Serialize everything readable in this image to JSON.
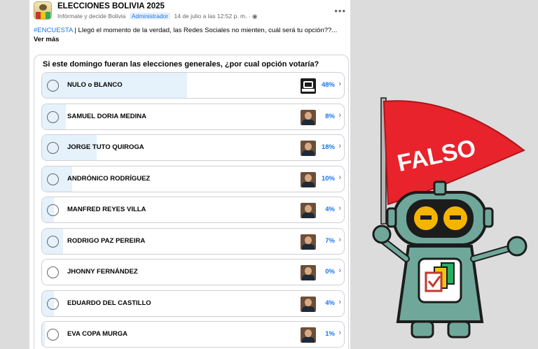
{
  "post": {
    "group_name": "ELECCIONES BOLIVIA 2025",
    "subtitle": "Infórmate y decide Bolivia",
    "role_badge": "Administrador",
    "timestamp": "14 de julio a las 12:52 p. m. ·",
    "more_icon": "more-horizontal-icon",
    "hashtag": "#ENCUESTA",
    "text": " | Llegó el momento de la verdad, las Redes Sociales no mienten, cuál será tu opción??...",
    "see_more": "Ver más"
  },
  "poll": {
    "question": "Si este domingo fueran las elecciones generales, ¿por cual opción votaría?",
    "options": [
      {
        "label": "NULO o BLANCO",
        "percent": 48,
        "percent_text": "48%"
      },
      {
        "label": "SAMUEL DORIA MEDINA",
        "percent": 8,
        "percent_text": "8%"
      },
      {
        "label": "JORGE TUTO QUIROGA",
        "percent": 18,
        "percent_text": "18%"
      },
      {
        "label": "ANDRÓNICO RODRÍGUEZ",
        "percent": 10,
        "percent_text": "10%"
      },
      {
        "label": "MANFRED REYES VILLA",
        "percent": 4,
        "percent_text": "4%"
      },
      {
        "label": "RODRIGO PAZ PEREIRA",
        "percent": 7,
        "percent_text": "7%"
      },
      {
        "label": "JHONNY FERNÁNDEZ",
        "percent": 0,
        "percent_text": "0%"
      },
      {
        "label": "EDUARDO DEL CASTILLO",
        "percent": 4,
        "percent_text": "4%"
      },
      {
        "label": "EVA COPA MURGA",
        "percent": 1,
        "percent_text": "1%"
      }
    ],
    "chevron": "›"
  },
  "stamp": {
    "flag_text": "FALSO",
    "colors": {
      "flag": "#e8232b",
      "robot_body": "#6fa89a",
      "robot_outline": "#1c1c1c",
      "eyes": "#f4b400"
    }
  },
  "colors": {
    "accent": "#1877f2",
    "fill": "#e5f1fb",
    "page_bg": "#dcdcdc"
  }
}
